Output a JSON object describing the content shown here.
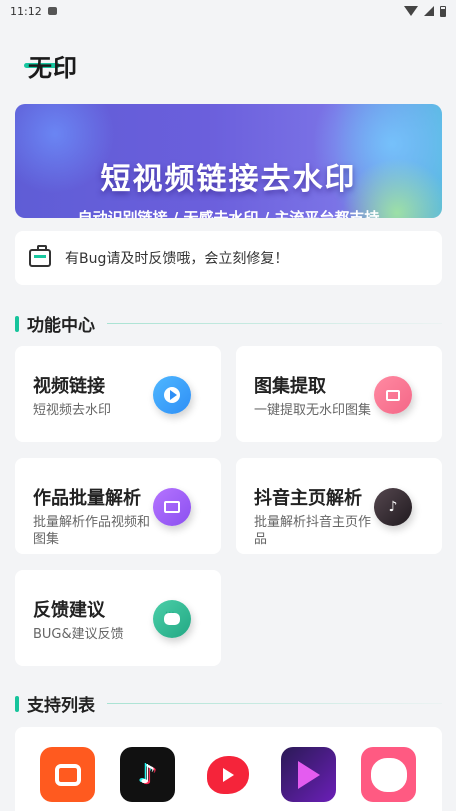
{
  "status_bar": {
    "time": "11:12"
  },
  "app": {
    "logo": "无印"
  },
  "banner": {
    "title": "短视频链接去水印",
    "subtitle": "自动识别链接 / 无感去水印 / 主流平台都支持"
  },
  "notice": {
    "text": "有Bug请及时反馈哦，会立刻修复！"
  },
  "sections": {
    "features": {
      "title": "功能中心"
    },
    "support": {
      "title": "支持列表"
    }
  },
  "features": [
    {
      "title": "视频链接",
      "desc": "短视频去水印",
      "icon": "video-play-icon"
    },
    {
      "title": "图集提取",
      "desc": "一键提取无水印图集",
      "icon": "image-icon"
    },
    {
      "title": "作品批量解析",
      "desc": "批量解析作品视频和图集",
      "icon": "film-icon"
    },
    {
      "title": "抖音主页解析",
      "desc": "批量解析抖音主页作品",
      "icon": "douyin-icon"
    },
    {
      "title": "反馈建议",
      "desc": "BUG&建议反馈",
      "icon": "chat-icon"
    }
  ],
  "supported_apps": [
    "kuaishou-icon",
    "tiktok-icon",
    "weishi-icon",
    "weishi-video-icon",
    "pipixia-icon"
  ],
  "colors": {
    "accent": "#17c49c",
    "banner": "#6b5fdc"
  }
}
